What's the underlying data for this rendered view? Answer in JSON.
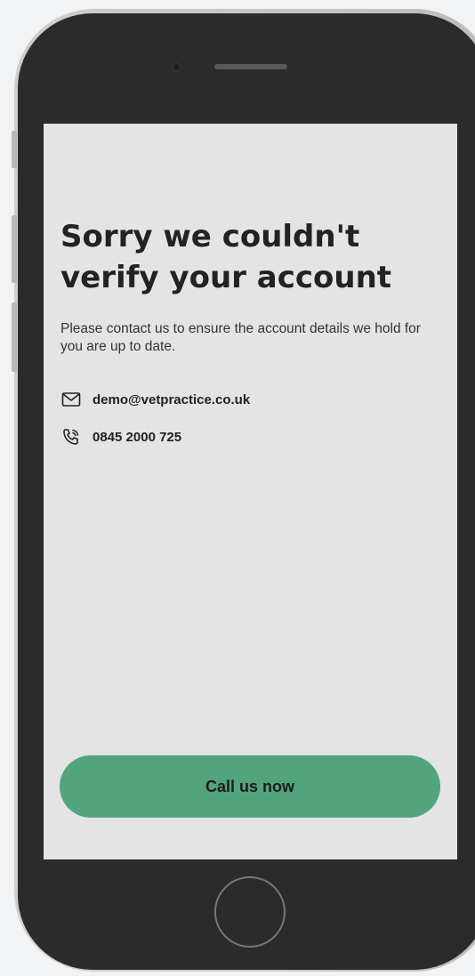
{
  "screen": {
    "headline": "Sorry we couldn't verify your account",
    "message": "Please contact us to ensure the account details we hold for you are up to date.",
    "contacts": [
      {
        "icon": "envelope-icon",
        "text": "demo@vetpractice.co.uk"
      },
      {
        "icon": "phone-call-icon",
        "text": "0845 2000 725"
      }
    ],
    "cta_label": "Call us now"
  },
  "colors": {
    "screen_background": "#e4e4e4",
    "button_green": "#52a47e",
    "device_frame": "#2b2b2b",
    "text_dark": "#222222"
  }
}
